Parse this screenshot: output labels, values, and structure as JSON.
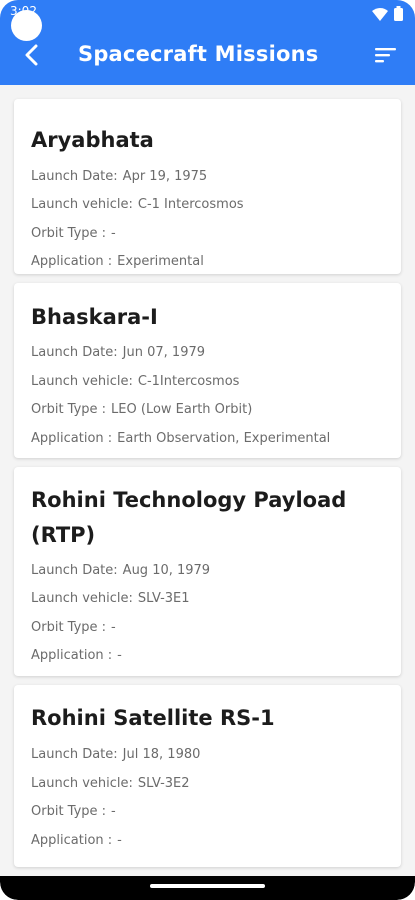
{
  "status_bar": {
    "time": "3:02"
  },
  "app_bar": {
    "title": "Spacecraft Missions"
  },
  "missions": [
    {
      "name": "Aryabhata",
      "launch_date_label": "Launch Date:",
      "launch_date": "Apr 19, 1975",
      "launch_vehicle_label": "Launch vehicle:",
      "launch_vehicle": "C-1 Intercosmos",
      "orbit_type_label": "Orbit Type :",
      "orbit_type": "-",
      "application_label": "Application :",
      "application": "Experimental"
    },
    {
      "name": "Bhaskara-I",
      "launch_date_label": "Launch Date:",
      "launch_date": "Jun 07, 1979",
      "launch_vehicle_label": "Launch vehicle:",
      "launch_vehicle": "C-1Intercosmos",
      "orbit_type_label": "Orbit Type :",
      "orbit_type": "LEO (Low Earth Orbit)",
      "application_label": "Application :",
      "application": "Earth Observation, Experimental"
    },
    {
      "name": "Rohini Technology Payload (RTP)",
      "launch_date_label": "Launch Date:",
      "launch_date": "Aug 10, 1979",
      "launch_vehicle_label": "Launch vehicle:",
      "launch_vehicle": "SLV-3E1",
      "orbit_type_label": "Orbit Type :",
      "orbit_type": "-",
      "application_label": "Application :",
      "application": "-"
    },
    {
      "name": "Rohini Satellite RS-1",
      "launch_date_label": "Launch Date:",
      "launch_date": "Jul 18, 1980",
      "launch_vehicle_label": "Launch vehicle:",
      "launch_vehicle": "SLV-3E2",
      "orbit_type_label": "Orbit Type :",
      "orbit_type": "-",
      "application_label": "Application :",
      "application": "-"
    }
  ],
  "colors": {
    "accent": "#2f7df6",
    "background": "#f4f4f4",
    "card": "#ffffff",
    "label": "#6b6b6b"
  },
  "icons": {
    "back": "arrow-back-icon",
    "sort": "sort-icon",
    "wifi": "wifi-icon",
    "battery": "battery-icon"
  }
}
